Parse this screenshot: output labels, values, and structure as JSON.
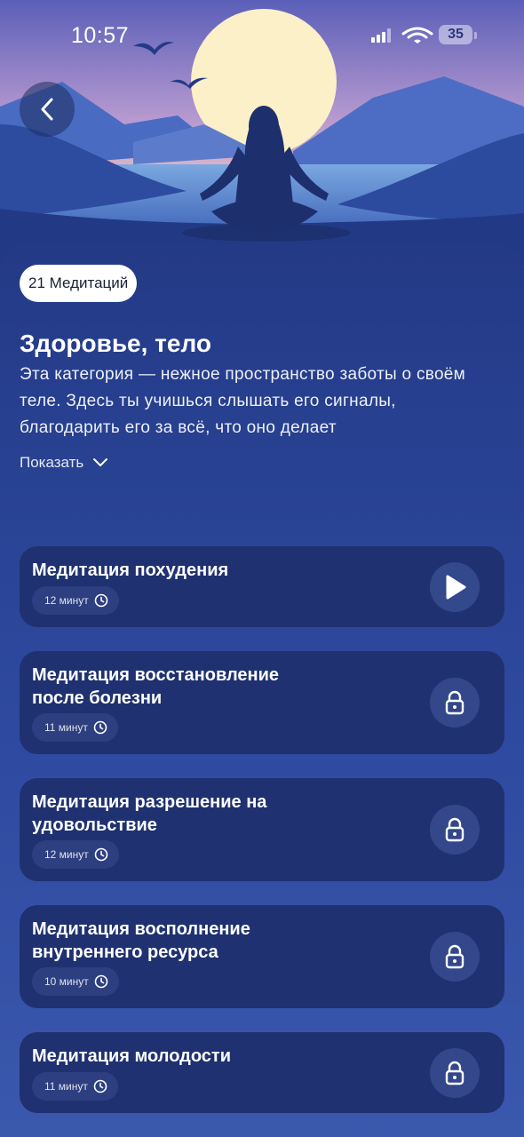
{
  "status_bar": {
    "time": "10:57",
    "battery": "35"
  },
  "header": {
    "back_icon": "chevron-left-icon"
  },
  "category": {
    "count_badge": "21 Медитаций",
    "title": "Здоровье, тело",
    "description": "Эта категория — нежное пространство заботы о своём теле. Здесь ты учишься слышать его сигналы, благодарить его за всё, что оно делает",
    "show_more": "Показать"
  },
  "meditations": [
    {
      "title": "Медитация похудения",
      "duration": "12 минут",
      "action_icon": "play-icon"
    },
    {
      "title": "Медитация восстановление после болезни",
      "duration": "11 минут",
      "action_icon": "lock-icon"
    },
    {
      "title": "Медитация разрешение на удовольствие",
      "duration": "12 минут",
      "action_icon": "lock-icon"
    },
    {
      "title": "Медитация восполнение внутреннего ресурса",
      "duration": "10 минут",
      "action_icon": "lock-icon"
    },
    {
      "title": "Медитация молодости",
      "duration": "11 минут",
      "action_icon": "lock-icon"
    }
  ],
  "colors": {
    "sheet": "#2a4590",
    "card": "#1f3170",
    "badge_bg": "#ffffff"
  }
}
